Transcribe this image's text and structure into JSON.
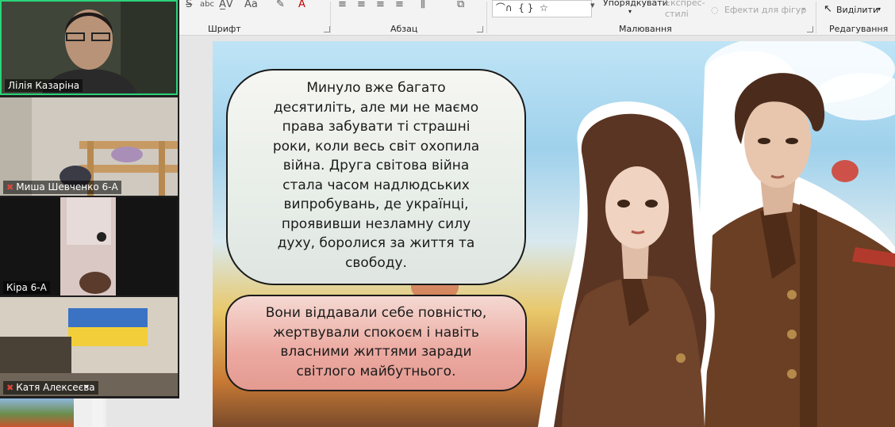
{
  "ribbon": {
    "groups": [
      "Шрифт",
      "Абзац",
      "Малювання",
      "Редагування"
    ],
    "arrange_label": "Упорядкувати",
    "quick_styles_label": "Експрес-стилі",
    "shape_effects_label": "Ефекти для фігур",
    "select_label": "Виділити"
  },
  "video": {
    "participants": [
      {
        "name": "Лілія Казаріна",
        "muted": false
      },
      {
        "name": "Миша Шевченко 6-А",
        "muted": true
      },
      {
        "name": "Кіра 6-А",
        "muted": false
      },
      {
        "name": "Катя Алексеєва",
        "muted": true
      }
    ]
  },
  "slide": {
    "bubble1_lines": [
      "Минуло вже багато",
      "десятиліть, але ми не маємо",
      "права забувати ті страшні",
      "роки, коли весь світ охопила",
      "війна. Друга світова війна",
      "стала часом надлюдських",
      "випробувань, де українці,",
      "проявивши незламну силу",
      "духу, боролися за життя та",
      "свободу."
    ],
    "bubble2_lines": [
      "Вони віддавали себе повністю,",
      "жертвували спокоєм і навіть",
      "власними життями заради",
      "світлого майбутнього."
    ]
  },
  "colors": {
    "active_speaker": "#2bd37a",
    "muted_icon": "#e0463b"
  }
}
